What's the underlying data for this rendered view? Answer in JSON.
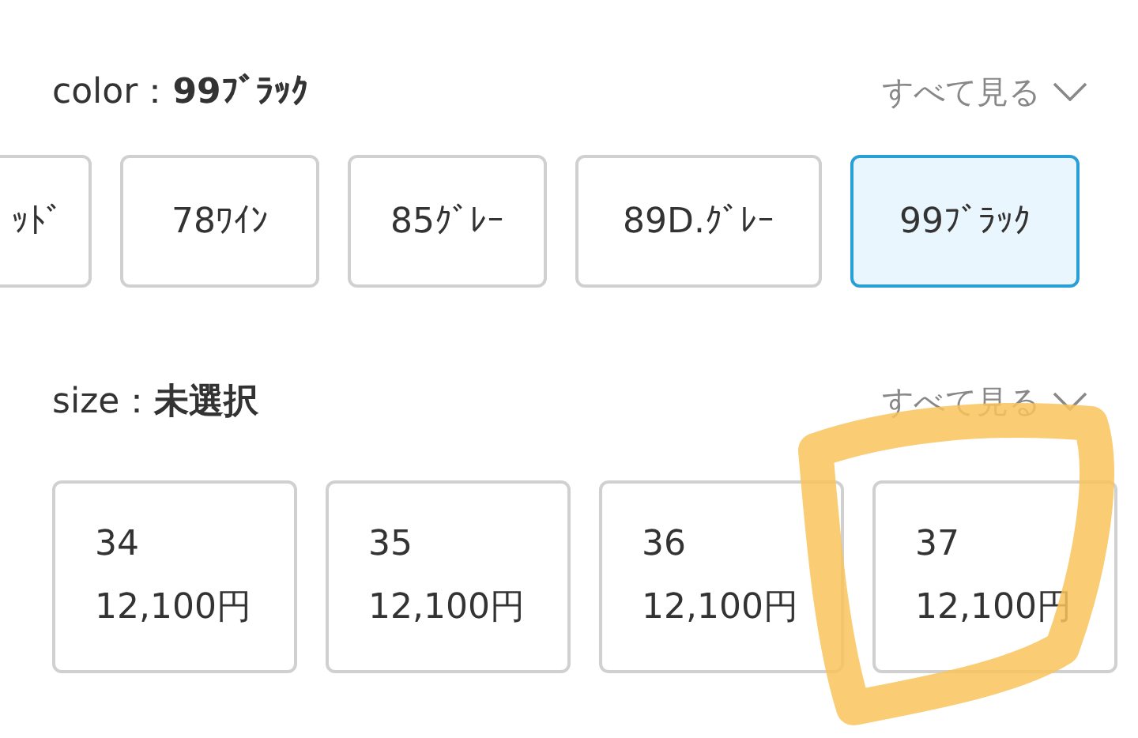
{
  "sections": [
    {
      "kind": "color",
      "label": "color：",
      "value": "99ﾌﾞﾗｯｸ",
      "see_all": "すべて見る",
      "options": [
        {
          "label": "ｯﾄﾞ",
          "selected": false
        },
        {
          "label": "78ﾜｲﾝ",
          "selected": false
        },
        {
          "label": "85ｸﾞﾚｰ",
          "selected": false
        },
        {
          "label": "89D.ｸﾞﾚｰ",
          "selected": false
        },
        {
          "label": "99ﾌﾞﾗｯｸ",
          "selected": true
        }
      ]
    },
    {
      "kind": "size",
      "label": "size：",
      "value": "未選択",
      "see_all": "すべて見る",
      "options": [
        {
          "size": "34",
          "price": "12,100円",
          "selected": false
        },
        {
          "size": "35",
          "price": "12,100円",
          "selected": false
        },
        {
          "size": "36",
          "price": "12,100円",
          "selected": false
        },
        {
          "size": "37",
          "price": "12,100円",
          "selected": false
        }
      ]
    }
  ],
  "annotation": {
    "kind": "scribble"
  }
}
